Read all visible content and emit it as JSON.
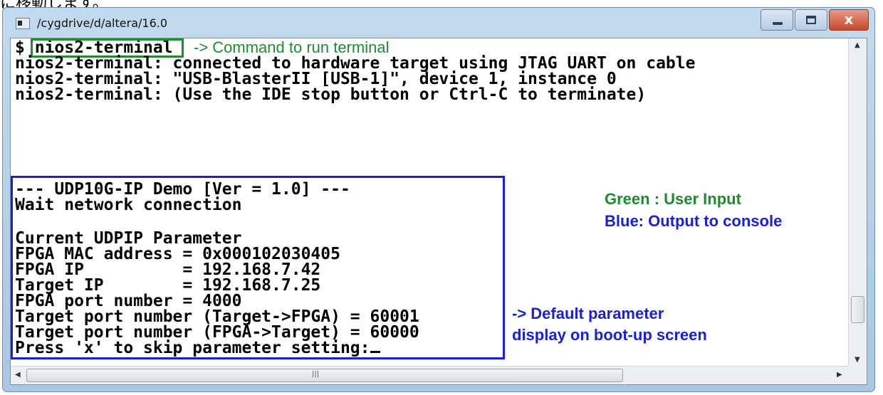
{
  "page": {
    "top_note": "に移動します。"
  },
  "window": {
    "title": "/cygdrive/d/altera/16.0",
    "icon": "console-window-icon",
    "buttons": {
      "minimize": "minimize-icon",
      "maximize": "maximize-icon",
      "close_glyph": "x"
    }
  },
  "console": {
    "prompt": "$",
    "command": "nios2-terminal",
    "lines": [
      "nios2-terminal: connected to hardware target using JTAG UART on cable",
      "nios2-terminal: \"USB-BlasterII [USB-1]\", device 1, instance 0",
      "nios2-terminal: (Use the IDE stop button or Ctrl-C to terminate)",
      "--- UDP10G-IP Demo [Ver = 1.0] ---",
      "Wait network connection",
      "Current UDPIP Parameter",
      "FPGA MAC address = 0x000102030405",
      "FPGA IP          = 192.168.7.42",
      "Target IP        = 192.168.7.25",
      "FPGA port number = 4000",
      "Target port number (Target->FPGA) = 60001",
      "Target port number (FPGA->Target) = 60000",
      "Press 'x' to skip parameter setting:"
    ]
  },
  "annotations": {
    "command_note": "-> Command to run terminal",
    "legend_green": "Green : User Input",
    "legend_blue": "Blue: Output to console",
    "default_line1": "-> Default parameter",
    "default_line2": "display on boot-up screen"
  },
  "colors": {
    "user_input": "#1e8c2e",
    "console_output": "#1b20d8"
  }
}
